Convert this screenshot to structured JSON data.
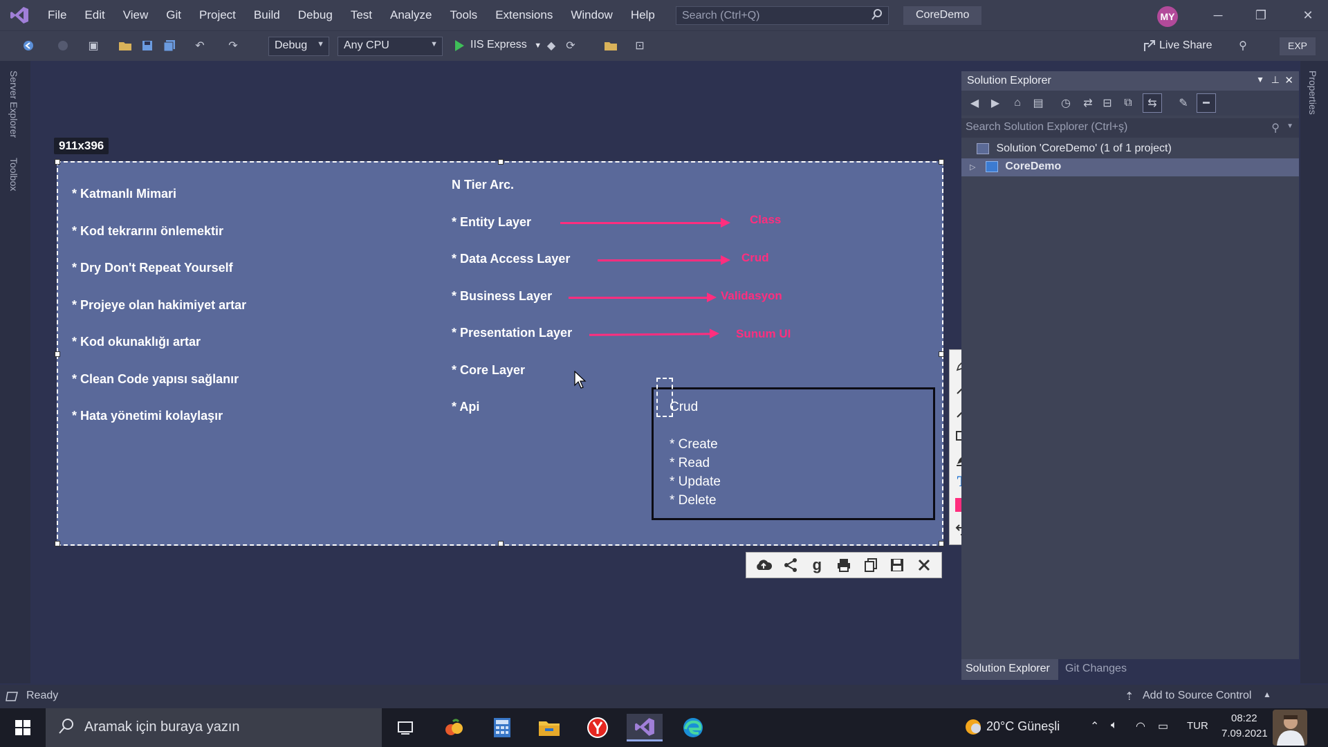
{
  "titlebar": {
    "menu": [
      "File",
      "Edit",
      "View",
      "Git",
      "Project",
      "Build",
      "Debug",
      "Test",
      "Analyze",
      "Tools",
      "Extensions",
      "Window",
      "Help"
    ],
    "search_placeholder": "Search (Ctrl+Q)",
    "solution_name": "CoreDemo",
    "avatar_initials": "MY"
  },
  "toolbar": {
    "config": "Debug",
    "platform": "Any CPU",
    "run_target": "IIS Express",
    "live_share": "Live Share",
    "exp": "EXP"
  },
  "side_tabs": {
    "server_explorer": "Server Explorer",
    "toolbox": "Toolbox",
    "properties": "Properties"
  },
  "snip": {
    "size_label": "911x396",
    "left_notes": [
      "* Katmanlı Mimari",
      "* Kod tekrarını önlemektir",
      "* Dry Don't Repeat Yourself",
      "* Projeye olan hakimiyet artar",
      "* Kod okunaklığı artar",
      "* Clean Code yapısı sağlanır",
      "* Hata yönetimi kolaylaşır"
    ],
    "tier_title": "N Tier Arc.",
    "layers": [
      "* Entity Layer",
      "* Data Access Layer",
      "* Business Layer",
      "* Presentation Layer",
      "* Core Layer",
      "* Api"
    ],
    "annotations": [
      "Class",
      "Crud",
      "Validasyon",
      "Sunum UI"
    ],
    "crud_title": "Crud",
    "crud_items": [
      "* Create",
      "* Read",
      "* Update",
      "* Delete"
    ],
    "pen_color": "#ff2e7e"
  },
  "solution_explorer": {
    "title": "Solution Explorer",
    "search_placeholder": "Search Solution Explorer (Ctrl+ş)",
    "solution_row": "Solution 'CoreDemo' (1 of 1 project)",
    "project_row": "CoreDemo",
    "tabs": [
      "Solution Explorer",
      "Git Changes"
    ]
  },
  "statusbar": {
    "status": "Ready",
    "source_control": "Add to Source Control"
  },
  "taskbar": {
    "search_placeholder": "Aramak için buraya yazın",
    "weather": "20°C  Güneşli",
    "language": "TUR",
    "time": "08:22",
    "date": "7.09.2021"
  }
}
